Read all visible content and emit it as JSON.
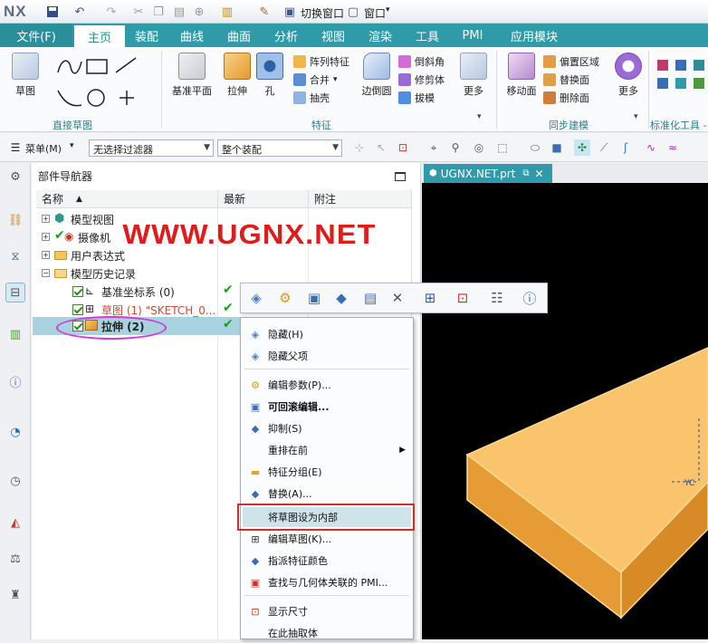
{
  "app": {
    "logo": "NX"
  },
  "quickaccess": {
    "switch_window": "切换窗口",
    "window_menu": "窗口"
  },
  "ribbon_tabs": [
    "文件(F)",
    "主页",
    "装配",
    "曲线",
    "曲面",
    "分析",
    "视图",
    "渲染",
    "工具",
    "PMI",
    "应用模块"
  ],
  "ribbon": {
    "sketch": "草图",
    "group_direct_sketch": "直接草图",
    "datum_plane": "基准平面",
    "extrude": "拉伸",
    "hole": "孔",
    "pattern_feature": "阵列特征",
    "unite": "合并",
    "shell": "抽壳",
    "edge_blend": "边倒圆",
    "chamfer": "倒斜角",
    "trim_body": "修剪体",
    "draft": "拔模",
    "more1": "更多",
    "group_feature": "特征",
    "move_face": "移动面",
    "offset_region": "偏置区域",
    "replace_face": "替换面",
    "delete_face": "删除面",
    "more2": "更多",
    "group_sync": "同步建模",
    "group_std": "标准化工具 -"
  },
  "toolbar2": {
    "menu": "菜单(M)",
    "filter": "无选择过滤器",
    "scope": "整个装配"
  },
  "navigator": {
    "title": "部件导航器",
    "col_name": "名称",
    "col_latest": "最新",
    "col_note": "附注",
    "items": [
      {
        "label": "模型视图"
      },
      {
        "label": "摄像机"
      },
      {
        "label": "用户表达式"
      },
      {
        "label": "模型历史记录"
      },
      {
        "label": "基准坐标系 (0)"
      },
      {
        "label": "草图 (1) \"SKETCH_0..."
      },
      {
        "label": "拉伸 (2)"
      }
    ]
  },
  "watermark": "WWW.UGNX.NET",
  "viewport": {
    "tab": "UGNX.NET.prt"
  },
  "context_menu": [
    {
      "label": "隐藏(H)",
      "icon": "hide-icon"
    },
    {
      "label": "隐藏父项",
      "icon": "hide-parents-icon"
    },
    {
      "label": "编辑参数(P)...",
      "icon": "edit-params-icon"
    },
    {
      "label": "可回滚编辑...",
      "icon": "rollback-edit-icon"
    },
    {
      "label": "抑制(S)",
      "icon": "suppress-icon"
    },
    {
      "label": "重排在前",
      "icon": "reorder-icon"
    },
    {
      "label": "特征分组(E)",
      "icon": "feature-group-icon"
    },
    {
      "label": "替换(A)...",
      "icon": "replace-icon"
    },
    {
      "label": "将草图设为内部",
      "icon": "make-internal-icon"
    },
    {
      "label": "编辑草图(K)...",
      "icon": "edit-sketch-icon"
    },
    {
      "label": "指派特征颜色",
      "icon": "feature-color-icon"
    },
    {
      "label": "查找与几何体关联的 PMI...",
      "icon": "find-pmi-icon"
    },
    {
      "label": "显示尺寸",
      "icon": "show-dims-icon"
    },
    {
      "label": "在此抽取体",
      "icon": "extract-body-icon"
    }
  ]
}
